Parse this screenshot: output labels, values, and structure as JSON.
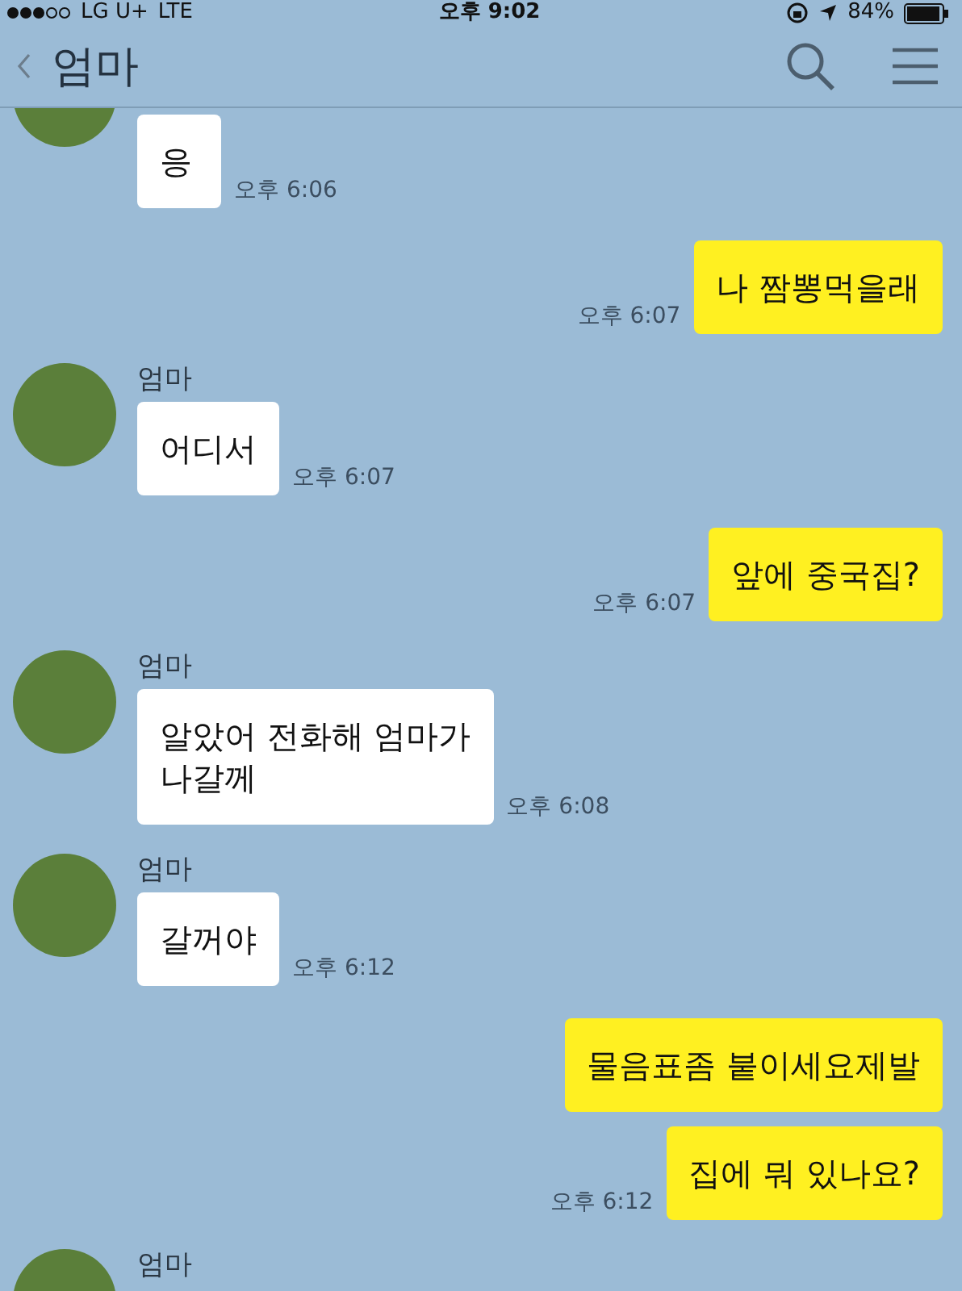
{
  "status_bar": {
    "carrier": "LG U+",
    "network": "LTE",
    "time": "오후 9:02",
    "battery": "84%"
  },
  "header": {
    "title": "엄마"
  },
  "messages": [
    {
      "kind": "received",
      "avatar": true,
      "text": "응",
      "time": "오후 6:06"
    },
    {
      "kind": "sent",
      "text": "나 짬뽕먹을래",
      "time": "오후 6:07"
    },
    {
      "kind": "received",
      "sender": "엄마",
      "avatar": true,
      "text": "어디서",
      "time": "오후 6:07"
    },
    {
      "kind": "sent",
      "text": "앞에 중국집?",
      "time": "오후 6:07"
    },
    {
      "kind": "received",
      "sender": "엄마",
      "avatar": true,
      "text": "알았어 전화해 엄마가\n나갈께",
      "time": "오후 6:08"
    },
    {
      "kind": "received",
      "sender": "엄마",
      "avatar": true,
      "text": "갈꺼야",
      "time": "오후 6:12"
    },
    {
      "kind": "sent",
      "text": "물음표좀 붙이세요제발"
    },
    {
      "kind": "sent",
      "text": "집에 뭐 있나요?",
      "time": "오후 6:12"
    },
    {
      "kind": "received",
      "sender": "엄마",
      "avatar": true
    }
  ]
}
